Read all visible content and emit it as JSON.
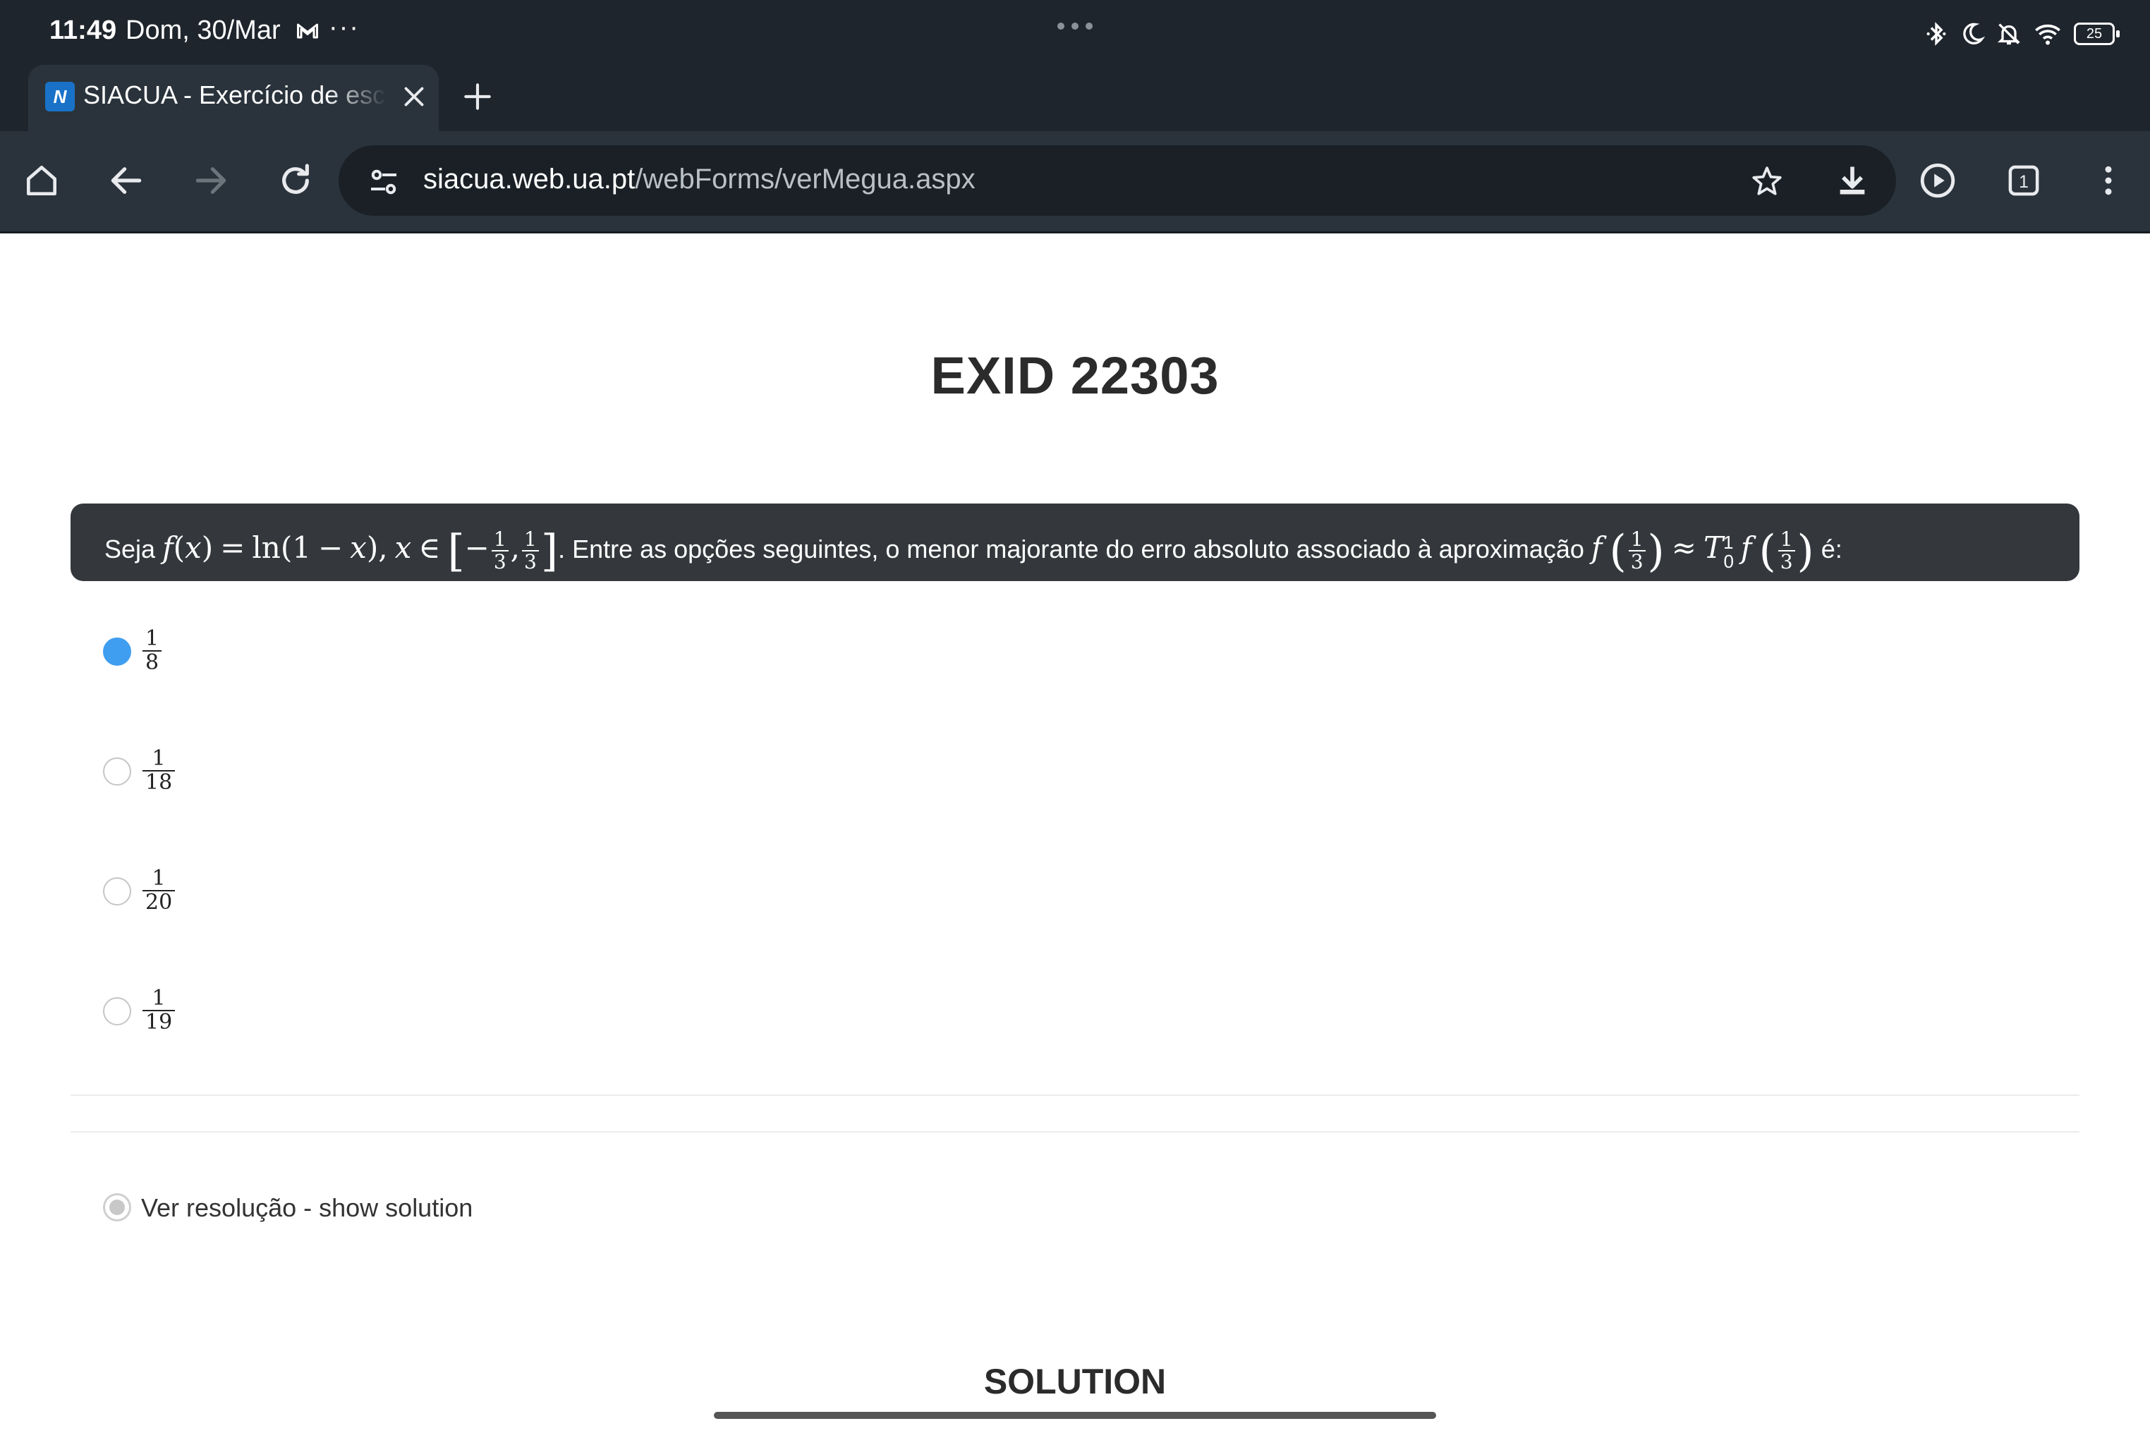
{
  "status_bar": {
    "time": "11:49",
    "date": "Dom, 30/Mar",
    "overflow": "···",
    "battery": "25",
    "icons": [
      "bluetooth-icon",
      "moon-icon",
      "bell-off-icon",
      "wifi-icon",
      "battery-icon"
    ]
  },
  "browser": {
    "tab_title": "SIACUA - Exercício de escolha múltipla",
    "favicon_text": "N",
    "url_domain": "siacua.web.ua.pt",
    "url_path": "/webForms/verMegua.aspx",
    "tab_count": "1"
  },
  "page": {
    "title": "EXID 22303",
    "question": {
      "seja": "Seja",
      "text_main": ". Entre as opções seguintes, o menor majorante do erro absoluto associado à aproximação",
      "end": "é:",
      "math": {
        "f": "f",
        "x": "x",
        "eq": "=",
        "ln": "ln",
        "minus": "−",
        "in": "∈",
        "approx": "≈",
        "T": "T",
        "T_sup": "1",
        "T_sub": "0",
        "one": "1",
        "three": "3"
      }
    },
    "options": [
      {
        "num": "1",
        "den": "8",
        "selected": true
      },
      {
        "num": "1",
        "den": "18",
        "selected": false
      },
      {
        "num": "1",
        "den": "20",
        "selected": false
      },
      {
        "num": "1",
        "den": "19",
        "selected": false
      }
    ],
    "show_solution_label": "Ver resolução - show solution",
    "solution_heading": "SOLUTION"
  },
  "colors": {
    "status_bg": "#1f252c",
    "toolbar_bg": "#2a333c",
    "question_bg": "#34383c",
    "radio_selected": "#3f9ef0"
  }
}
